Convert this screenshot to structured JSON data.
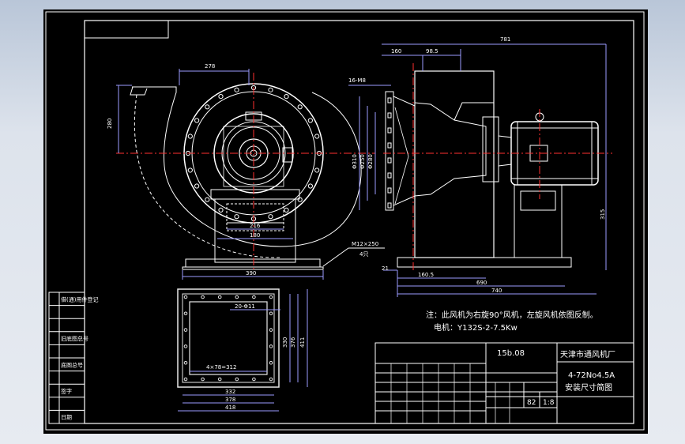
{
  "title_block": {
    "company": "天津市通风机厂",
    "drawing_no": "15b.08",
    "model": "4-72No4.5A",
    "drawing_title": "安装尺寸简图",
    "quantity": "82",
    "scale": "1:8"
  },
  "notes": {
    "line1": "注：此风机为右旋90°风机，左旋风机依图反制。",
    "line2": "电机：Y132S-2-7.5Kw"
  },
  "bolt_callout": {
    "spec": "M12×250",
    "count": "4只"
  },
  "dimensions": {
    "front_top": "278",
    "front_height": "280",
    "foot_inner": "216",
    "foot_outer": "180",
    "base_width": "390",
    "side_overall": "781",
    "side_a": "160",
    "side_b": "98.5",
    "side_holes": "16-M8",
    "side_left": "21",
    "side_c": "160.5",
    "side_d": "690",
    "side_e": "740",
    "side_height": "315",
    "phi1": "Φ310",
    "phi2": "Φ250",
    "phi3": "Φ280",
    "flange_holes": "20-Φ11",
    "flange_pitch": "4×78=312",
    "flange_w1": "332",
    "flange_w2": "378",
    "flange_w3": "418",
    "flange_h1": "330",
    "flange_h2": "376",
    "flange_h3": "411"
  },
  "left_panel_labels": [
    "借(通)用件登记",
    "",
    "",
    "旧底图总号",
    "",
    "底图总号",
    "",
    "签字",
    "",
    "日期"
  ],
  "colors": {
    "background": "#000000",
    "frame": "#ffffff",
    "centerline": "#ff3030",
    "outline": "#ffffff",
    "dimension": "#9b9bff",
    "flange": "#e8e8e8"
  }
}
